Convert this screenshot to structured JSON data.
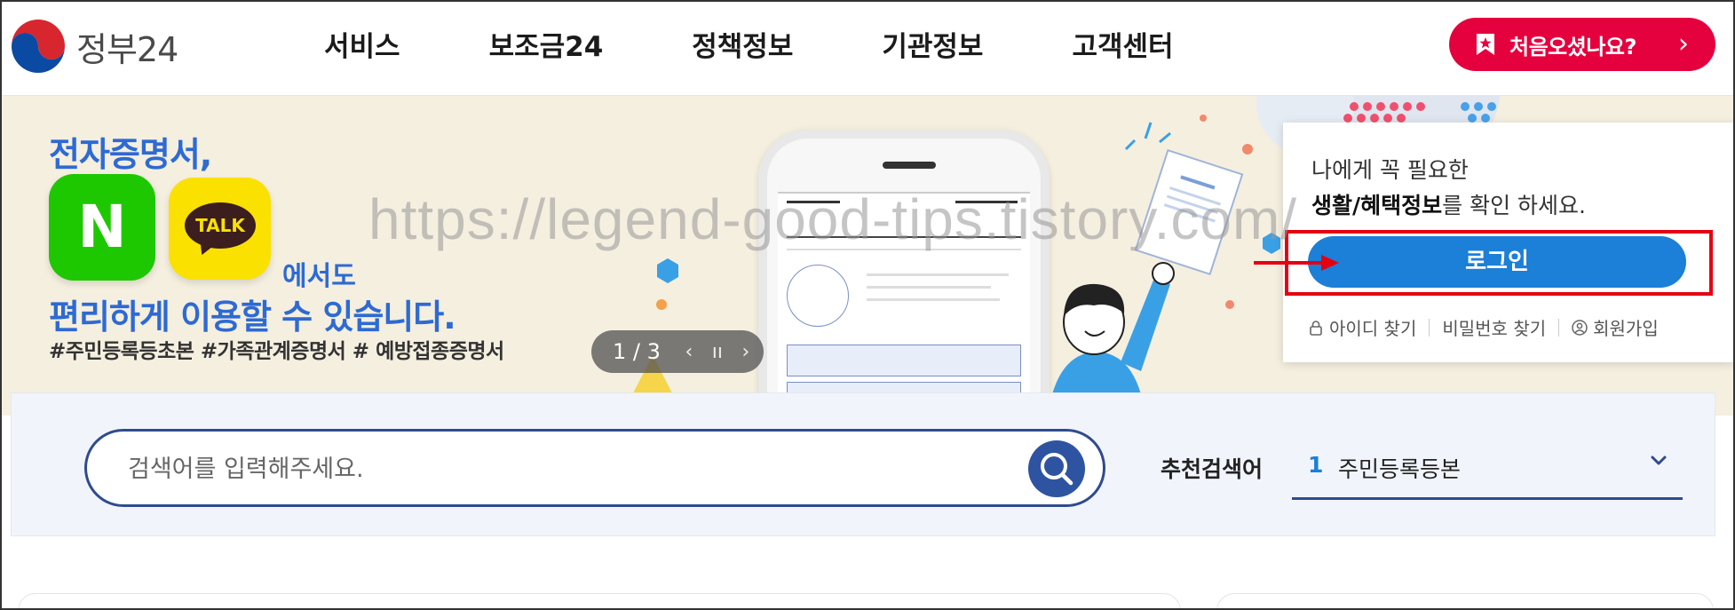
{
  "header": {
    "logo_text": "정부24",
    "nav": [
      "서비스",
      "보조금24",
      "정책정보",
      "기관정보",
      "고객센터"
    ],
    "first_visit_button": "처음오셨나요?"
  },
  "hero": {
    "title_line1": "전자증명서,",
    "app_n": "N",
    "app_talk": "TALK",
    "title_line2": "에서도",
    "title_line3": "편리하게 이용할 수 있습니다.",
    "tags": "#주민등록등초본  #가족관계증명서  # 예방접종증명서",
    "pager": "1 / 3"
  },
  "watermark": "https://legend-good-tips.tistory.com/",
  "login_card": {
    "line1": "나에게 꼭 필요한",
    "line2_bold": "생활/혜택정보",
    "line2_rest": "를 확인 하세요.",
    "login_button": "로그인",
    "find_id": "아이디 찾기",
    "find_pw": "비밀번호 찾기",
    "signup": "회원가입"
  },
  "search": {
    "placeholder": "검색어를 입력해주세요.",
    "recommend_label": "추천검색어",
    "recommend_rank": "1",
    "recommend_value": "주민등록등본"
  },
  "colors": {
    "primary_blue": "#1c7fd8",
    "navy": "#2f4b8f",
    "red": "#e5003e",
    "hero_bg": "#f5efe0"
  }
}
